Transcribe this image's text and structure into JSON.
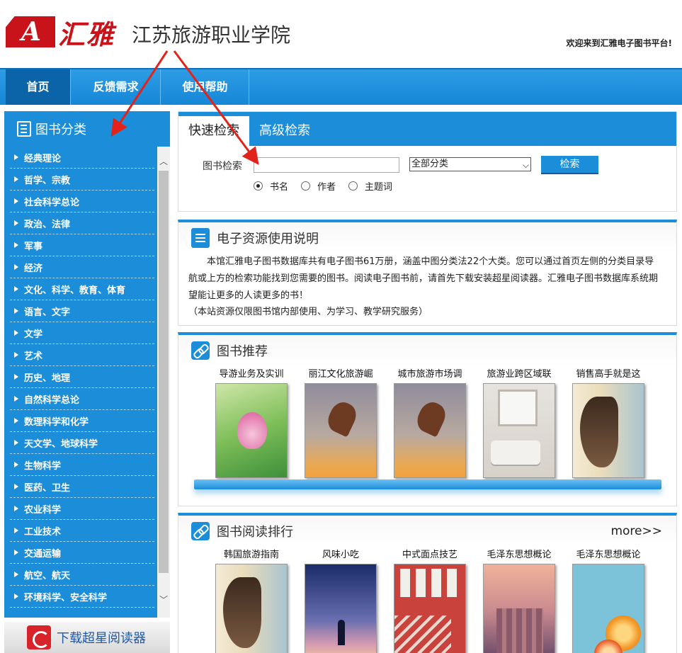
{
  "header": {
    "logo_a": "A",
    "logo_text": "汇雅",
    "school_name": "江苏旅游职业学院",
    "welcome": "欢迎来到汇雅电子图书平台!"
  },
  "nav": {
    "items": [
      {
        "label": "首页"
      },
      {
        "label": "反馈需求"
      },
      {
        "label": "使用帮助"
      }
    ]
  },
  "sidebar": {
    "title": "图书分类",
    "categories": [
      "经典理论",
      "哲学、宗教",
      "社会科学总论",
      "政治、法律",
      "军事",
      "经济",
      "文化、科学、教育、体育",
      "语言、文字",
      "文学",
      "艺术",
      "历史、地理",
      "自然科学总论",
      "数理科学和化学",
      "天文学、地球科学",
      "生物科学",
      "医药、卫生",
      "农业科学",
      "工业技术",
      "交通运输",
      "航空、航天",
      "环境科学、安全科学"
    ],
    "scroll_up": "︿",
    "scroll_down": "﹀",
    "download_label": "下载超星阅读器"
  },
  "search": {
    "tabs": [
      "快速检索",
      "高级检索"
    ],
    "label": "图书检索",
    "input_value": "",
    "select_value": "全部分类",
    "select_arrow": "⌵",
    "button_label": "检索",
    "radios": [
      {
        "label": "书名",
        "checked": true
      },
      {
        "label": "作者",
        "checked": false
      },
      {
        "label": "主题词",
        "checked": false
      }
    ]
  },
  "intro": {
    "title": "电子资源使用说明",
    "body": "本馆汇雅电子图书数据库共有电子图书61万册，涵盖中图分类法22个大类。您可以通过首页左侧的分类目录导航或上方的检索功能找到您需要的图书。阅读电子图书前，请首先下载安装超星阅读器。汇雅电子图书数据库系统期望能让更多的人读更多的书！",
    "note": "（本站资源仅限图书馆内部使用、为学习、教学研究服务）"
  },
  "recommend": {
    "title": "图书推荐",
    "books": [
      {
        "title": "导游业务及实训"
      },
      {
        "title": "丽江文化旅游崛"
      },
      {
        "title": "城市旅游市场调"
      },
      {
        "title": "旅游业跨区域联"
      },
      {
        "title": "销售高手就是这"
      }
    ]
  },
  "ranking": {
    "title": "图书阅读排行",
    "more": "more>>",
    "books": [
      {
        "title": "韩国旅游指南"
      },
      {
        "title": "风味小吃"
      },
      {
        "title": "中式面点技艺"
      },
      {
        "title": "毛泽东思想概论"
      },
      {
        "title": "毛泽东思想概论"
      }
    ]
  },
  "colors": {
    "brand_red": "#c9131b",
    "nav_blue": "#1b8dd9",
    "annotation_red": "#e2231a"
  }
}
